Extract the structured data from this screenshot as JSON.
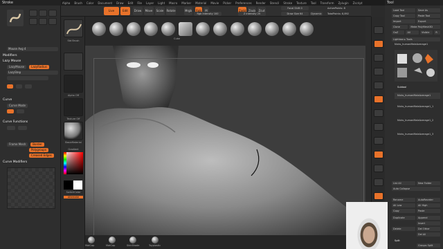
{
  "menu": {
    "items": [
      "Alpha",
      "Brush",
      "Color",
      "Document",
      "Draw",
      "Edit",
      "File",
      "Layer",
      "Light",
      "Macro",
      "Marker",
      "Material",
      "Movie",
      "Picker",
      "Preferences",
      "Render",
      "Stencil",
      "Stroke",
      "Texture",
      "Tool",
      "Transform",
      "Zplugin",
      "Zscript"
    ]
  },
  "left_tray": {
    "title": "Stroke",
    "sections": {
      "modifiers": "Modifiers",
      "lazy_mouse": "Lazy Mouse",
      "lazy_mouse_btn": "LazyMouse",
      "lazy_step": "LazyStep",
      "lazy_radius": "LazyRadius",
      "curve": "Curve",
      "curve_mode": "Curve Mode",
      "curve_functions": "Curve Functions",
      "frame_mesh": "Frame Mesh",
      "border": "Border",
      "polygroups": "Polygroups",
      "creased_edges": "Creased Edges",
      "curve_modifiers": "Curve Modifiers",
      "mouse_avg": "Mouse Avg 4"
    }
  },
  "second_tray": {
    "brush_label": "Std Brush",
    "alpha_label": "Alpha Off",
    "texture_label": "Texture Off",
    "material_label": "BasicMaterial",
    "gradient_label": "Gradient",
    "switch_color": "SwitchColor",
    "alternate": "Alternate"
  },
  "top_bar": {
    "edit": "Edit",
    "draw": "Draw",
    "move": "Move",
    "scale": "Scale",
    "rotate": "Rotate",
    "rgb": "Rgb",
    "mrgb": "Mrgb",
    "m": "M",
    "zadd": "Zadd",
    "zsub": "Zsub",
    "zcut": "Zcut",
    "focal_shift": "Focal Shift 0",
    "draw_size": "Draw Size 64",
    "dynamic": "Dynamic",
    "rgb_intensity": "Rgb Intensity 100",
    "z_intensity": "Z Intensity 25",
    "active_points": "ActivePoints: 8",
    "total_points": "TotalPoints: 8,892",
    "edit_active": "Live Boolean"
  },
  "brushes": [
    "Standard",
    "ClayBuildup",
    "DamStandard",
    "Move",
    "hPolish",
    "Inflate",
    "Cube",
    "Sphere",
    "Pinch",
    "Clay",
    "TrimDynamic",
    "Smooth",
    "Flatten"
  ],
  "bottom_brushes": [
    "MatCap",
    "MatCap",
    "SkinShade",
    "Toyplastic"
  ],
  "right_tray": {
    "title": "Tool",
    "load_tool": "Load Tool",
    "save_as": "Save As",
    "copy_tool": "Copy Tool",
    "paste_tool": "Paste Tool",
    "import": "Import",
    "export": "Export",
    "clone": "Clone",
    "make_polymesh": "Make PolyMesh3D",
    "goz": "GoZ",
    "all": "All",
    "visible": "Visible",
    "r": "R",
    "lightbox": "Lightbox ▸ Tools",
    "current_tool": "Nicks_humanMaleAverage1",
    "subtool": "Subtool",
    "subtools": [
      "Nicks_humanMaleAverage1",
      "Nicks_humanMaleAverage1_1",
      "Nicks_humanMaleAverage1_2",
      "Nicks_humanMaleAverage1_3"
    ],
    "list_all": "List All",
    "new_folder": "New Folder",
    "auto_collapse": "Auto Collapse",
    "rename": "Rename",
    "auto_reorder": "AutoReorder",
    "all_low": "All Low",
    "all_high": "All High",
    "copy": "Copy",
    "paste": "Paste",
    "duplicate": "Duplicate",
    "append": "Append",
    "insert": "Insert",
    "delete": "Delete",
    "del_other": "Del Other",
    "del_all": "Del All",
    "split": "Split",
    "groups_split": "Groups Split"
  },
  "colors": {
    "accent": "#e8722a",
    "bg": "#2b2b2b",
    "panel": "#2e2e2e"
  }
}
